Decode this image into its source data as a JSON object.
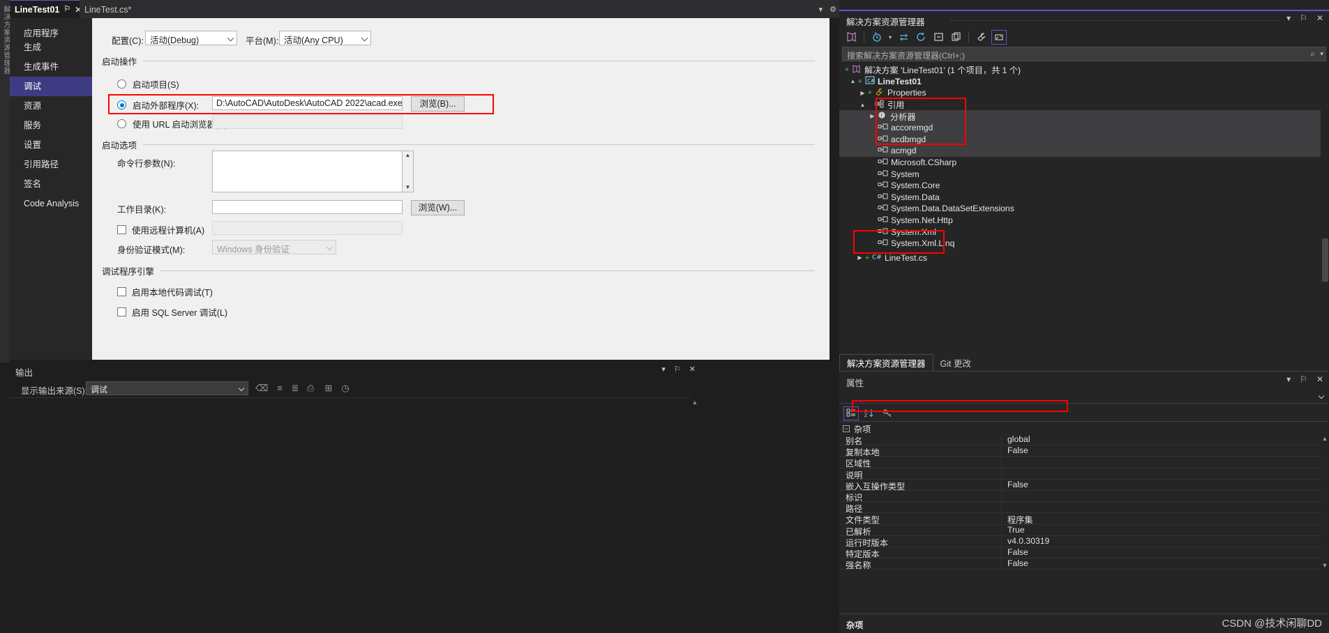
{
  "editor": {
    "tabs": [
      {
        "label": "LineTest01",
        "active": true,
        "pin": "auto-hide",
        "close": "×"
      },
      {
        "label": "LineTest.cs*",
        "active": false
      }
    ],
    "tools": {
      "chevron": "▾",
      "gear": "⚙"
    }
  },
  "left_sliver": {
    "label": "解决方案资源管理器"
  },
  "categories": [
    {
      "label": "应用程序"
    },
    {
      "label": "生成"
    },
    {
      "label": "生成事件"
    },
    {
      "label": "调试",
      "selected": true
    },
    {
      "label": "资源"
    },
    {
      "label": "服务"
    },
    {
      "label": "设置"
    },
    {
      "label": "引用路径"
    },
    {
      "label": "签名"
    },
    {
      "label": "Code Analysis"
    }
  ],
  "form": {
    "configuration_label": "配置(C):",
    "configuration_value": "活动(Debug)",
    "platform_label": "平台(M):",
    "platform_value": "活动(Any CPU)",
    "start_action_group": "启动操作",
    "radio_start_project": "启动项目(S)",
    "radio_start_external": "启动外部程序(X):",
    "external_program_path": "D:\\AutoCAD\\AutoDesk\\AutoCAD 2022\\acad.exe",
    "browse_b_button": "浏览(B)...",
    "radio_start_url": "使用 URL 启动浏览器(R):",
    "url_value": "",
    "start_options_group": "启动选项",
    "cmdline_label": "命令行参数(N):",
    "cmdline_value": "",
    "workdir_label": "工作目录(K):",
    "workdir_value": "",
    "browse_w_button": "浏览(W)...",
    "remote_machine_label": "使用远程计算机(A)",
    "remote_machine_value": "",
    "auth_mode_label": "身份验证模式(M):",
    "auth_mode_value": "Windows 身份验证",
    "debugger_engines_group": "调试程序引擎",
    "enable_native_label": "启用本地代码调试(T)",
    "enable_sql_label": "启用 SQL Server 调试(L)"
  },
  "output": {
    "title": "输出",
    "head_tools": {
      "chevron": "▾",
      "pin": "⚐",
      "close": "✕"
    },
    "source_label": "显示输出来源(S):",
    "source_value": "调试",
    "toolbar_icons": [
      "clear-all-icon",
      "toggle-word-wrap-icon",
      "toggle-message-icon",
      "show-output-icon",
      "find-icon",
      "clock-icon"
    ],
    "body_text": ""
  },
  "solution_explorer": {
    "title": "解决方案资源管理器",
    "head_tools": {
      "chevron": "▾",
      "pin": "⚐",
      "close": "✕"
    },
    "toolbar_icons": [
      "code-view-icon",
      "pending-changes-icon",
      "sync-with-active-icon",
      "refresh-icon",
      "collapse-all-icon",
      "show-all-files-icon",
      "properties-wrench-icon",
      "preview-selected-icon"
    ],
    "search_placeholder": "搜索解决方案资源管理器(Ctrl+;)",
    "tree": [
      {
        "label": "解决方案 'LineTest01' (1 个项目，共 1 个)",
        "indent": 0,
        "twisty": "",
        "plus": "+",
        "icon": "solution-icon",
        "bold": false,
        "selected": false
      },
      {
        "label": "LineTest01",
        "indent": 1,
        "twisty": "▲",
        "plus": "+",
        "icon": "csharp-project-icon",
        "bold": true,
        "selected": false
      },
      {
        "label": "Properties",
        "indent": 2,
        "twisty": "▶",
        "plus": "+",
        "icon": "wrench-icon",
        "bold": false,
        "selected": false
      },
      {
        "label": "引用",
        "indent": 2,
        "twisty": "▲",
        "plus": "",
        "icon": "references-icon",
        "bold": false,
        "selected": false
      },
      {
        "label": "分析器",
        "indent": 3,
        "twisty": "▶",
        "plus": "",
        "icon": "analyzer-icon",
        "bold": false,
        "selected": true
      },
      {
        "label": "accoremgd",
        "indent": 3,
        "twisty": "",
        "plus": "",
        "icon": "assembly-icon",
        "bold": false,
        "selected": true
      },
      {
        "label": "acdbmgd",
        "indent": 3,
        "twisty": "",
        "plus": "",
        "icon": "assembly-icon",
        "bold": false,
        "selected": true
      },
      {
        "label": "acmgd",
        "indent": 3,
        "twisty": "",
        "plus": "",
        "icon": "assembly-icon",
        "bold": false,
        "selected": true
      },
      {
        "label": "Microsoft.CSharp",
        "indent": 3,
        "twisty": "",
        "plus": "",
        "icon": "assembly-icon",
        "bold": false,
        "selected": false
      },
      {
        "label": "System",
        "indent": 3,
        "twisty": "",
        "plus": "",
        "icon": "assembly-icon",
        "bold": false,
        "selected": false
      },
      {
        "label": "System.Core",
        "indent": 3,
        "twisty": "",
        "plus": "",
        "icon": "assembly-icon",
        "bold": false,
        "selected": false
      },
      {
        "label": "System.Data",
        "indent": 3,
        "twisty": "",
        "plus": "",
        "icon": "assembly-icon",
        "bold": false,
        "selected": false
      },
      {
        "label": "System.Data.DataSetExtensions",
        "indent": 3,
        "twisty": "",
        "plus": "",
        "icon": "assembly-icon",
        "bold": false,
        "selected": false
      },
      {
        "label": "System.Net.Http",
        "indent": 3,
        "twisty": "",
        "plus": "",
        "icon": "assembly-icon",
        "bold": false,
        "selected": false
      },
      {
        "label": "System.Xml",
        "indent": 3,
        "twisty": "",
        "plus": "",
        "icon": "assembly-icon",
        "bold": false,
        "selected": false
      },
      {
        "label": "System.Xml.Linq",
        "indent": 3,
        "twisty": "",
        "plus": "",
        "icon": "assembly-icon",
        "bold": false,
        "selected": false
      },
      {
        "label": "LineTest.cs",
        "indent": 2,
        "twisty": "▶",
        "plus": "+",
        "icon": "csharp-file-icon",
        "bold": false,
        "selected": false
      }
    ],
    "tabs": [
      {
        "label": "解决方案资源管理器",
        "active": true
      },
      {
        "label": "Git 更改",
        "active": false
      }
    ]
  },
  "properties": {
    "title": "属性",
    "head_tools": {
      "chevron": "▾",
      "pin": "⚐",
      "close": "✕"
    },
    "object_value": "",
    "toolbar_icons": [
      "categorized-icon",
      "alphabetical-sort-icon",
      "property-pages-key-icon"
    ],
    "category": "杂项",
    "rows": [
      {
        "name": "别名",
        "value": "global",
        "highlight": false
      },
      {
        "name": "复制本地",
        "value": "False",
        "highlight": true
      },
      {
        "name": "区域性",
        "value": "",
        "highlight": false
      },
      {
        "name": "说明",
        "value": "",
        "highlight": false
      },
      {
        "name": "嵌入互操作类型",
        "value": "False",
        "highlight": false
      },
      {
        "name": "标识",
        "value": "",
        "highlight": false
      },
      {
        "name": "路径",
        "value": "",
        "highlight": false
      },
      {
        "name": "文件类型",
        "value": "程序集",
        "highlight": false
      },
      {
        "name": "已解析",
        "value": "True",
        "highlight": false
      },
      {
        "name": "运行时版本",
        "value": "v4.0.30319",
        "highlight": false
      },
      {
        "name": "特定版本",
        "value": "False",
        "highlight": false
      },
      {
        "name": "强名称",
        "value": "False",
        "highlight": false
      }
    ],
    "footer": "杂项"
  },
  "watermark": "CSDN @技术闲聊DD",
  "colors": {
    "accent_purple": "#6b4fc9",
    "annotation_red": "#ff0000",
    "selection_blue": "#0078d4",
    "sidebar_selected": "#3f3b83"
  }
}
